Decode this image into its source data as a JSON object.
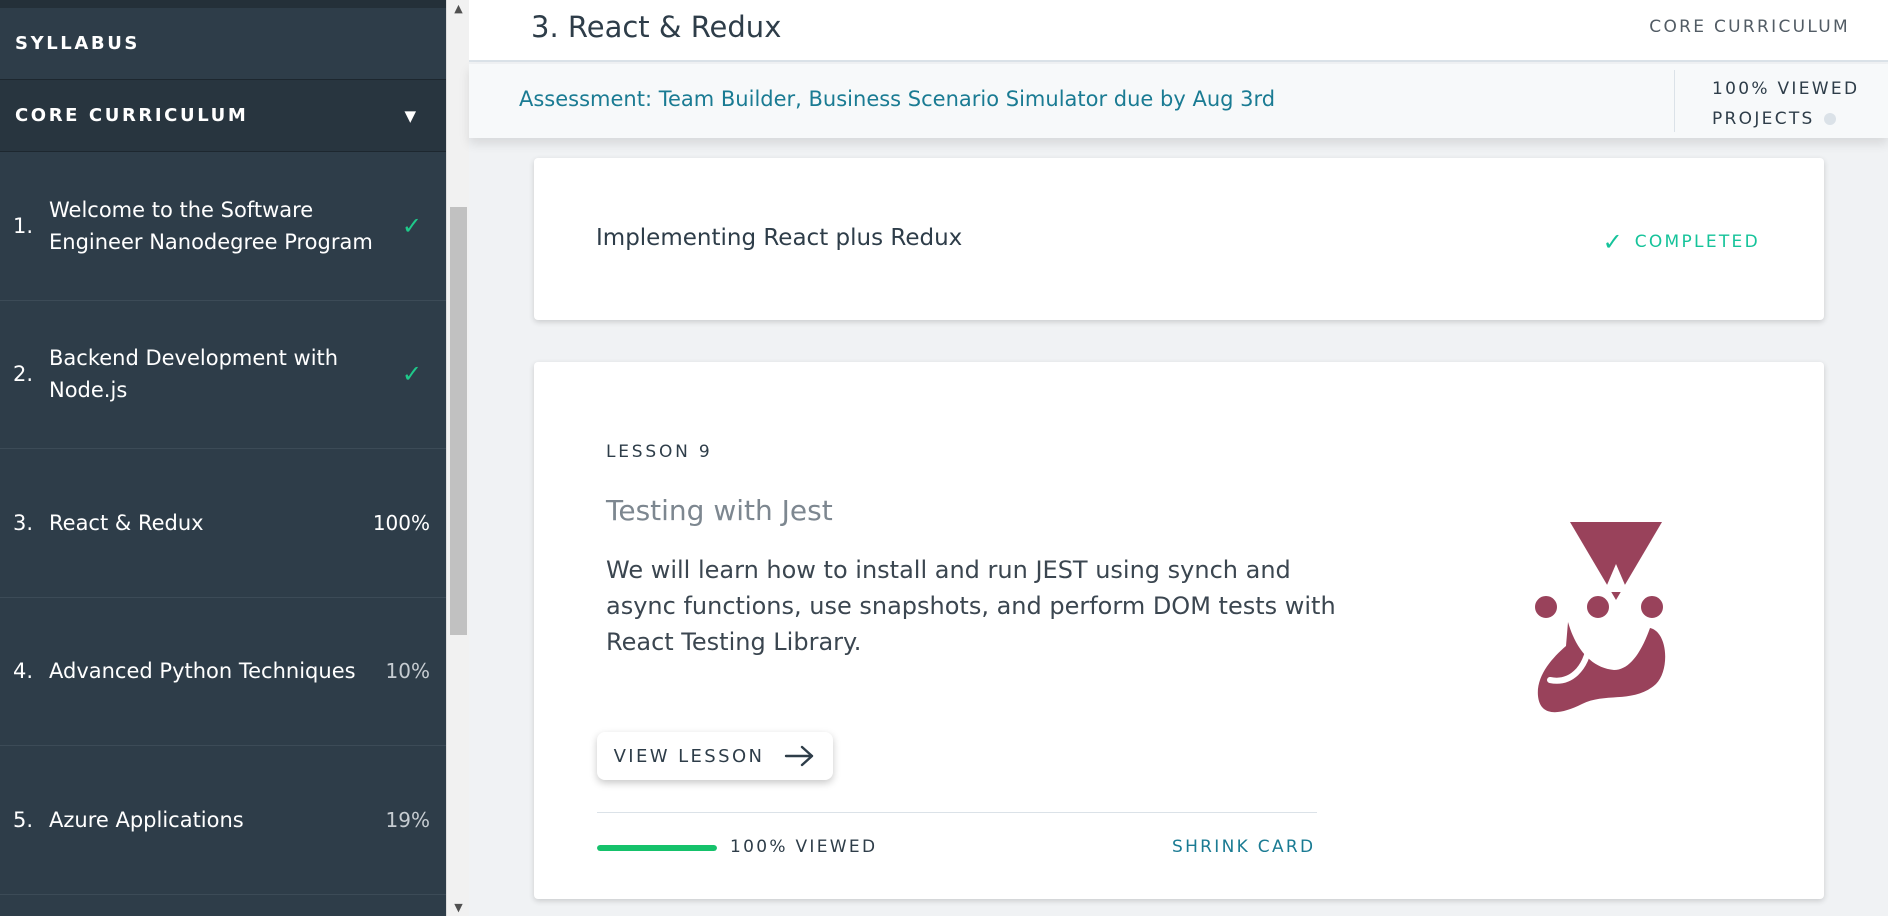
{
  "sidebar": {
    "syllabus_label": "SYLLABUS",
    "section_label": "CORE CURRICULUM",
    "section_caret": "▼",
    "items": [
      {
        "num": "1.",
        "label": "Welcome to the Software Engineer Nanodegree Program",
        "status": "✓"
      },
      {
        "num": "2.",
        "label": "Backend Development with Node.js",
        "status": "✓"
      },
      {
        "num": "3.",
        "label": "React & Redux",
        "status": "100%"
      },
      {
        "num": "4.",
        "label": "Advanced Python Techniques",
        "status": "10%"
      },
      {
        "num": "5.",
        "label": "Azure Applications",
        "status": "19%"
      }
    ]
  },
  "header": {
    "title": "3. React & Redux",
    "section": "CORE CURRICULUM",
    "assessment": "Assessment: Team Builder, Business Scenario Simulator due by Aug 3rd",
    "viewed": "100% VIEWED",
    "projects": "PROJECTS"
  },
  "completed_card": {
    "title": "Implementing React plus Redux",
    "status": "COMPLETED"
  },
  "lesson_card": {
    "kicker": "LESSON 9",
    "title": "Testing with Jest",
    "description": "We will learn how to install and run JEST using synch and async functions, use snapshots, and perform DOM tests with React Testing Library.",
    "button": "VIEW LESSON",
    "progress": 1.0,
    "progress_label": "100% VIEWED",
    "shrink": "SHRINK CARD",
    "logo_icon": "jest-logo"
  },
  "colors": {
    "sidebar_bg": "#2e3d49",
    "accent_teal": "#1a7b93",
    "success_green": "#15c39a",
    "progress_green": "#15c26b",
    "jest_maroon": "#99425b"
  }
}
